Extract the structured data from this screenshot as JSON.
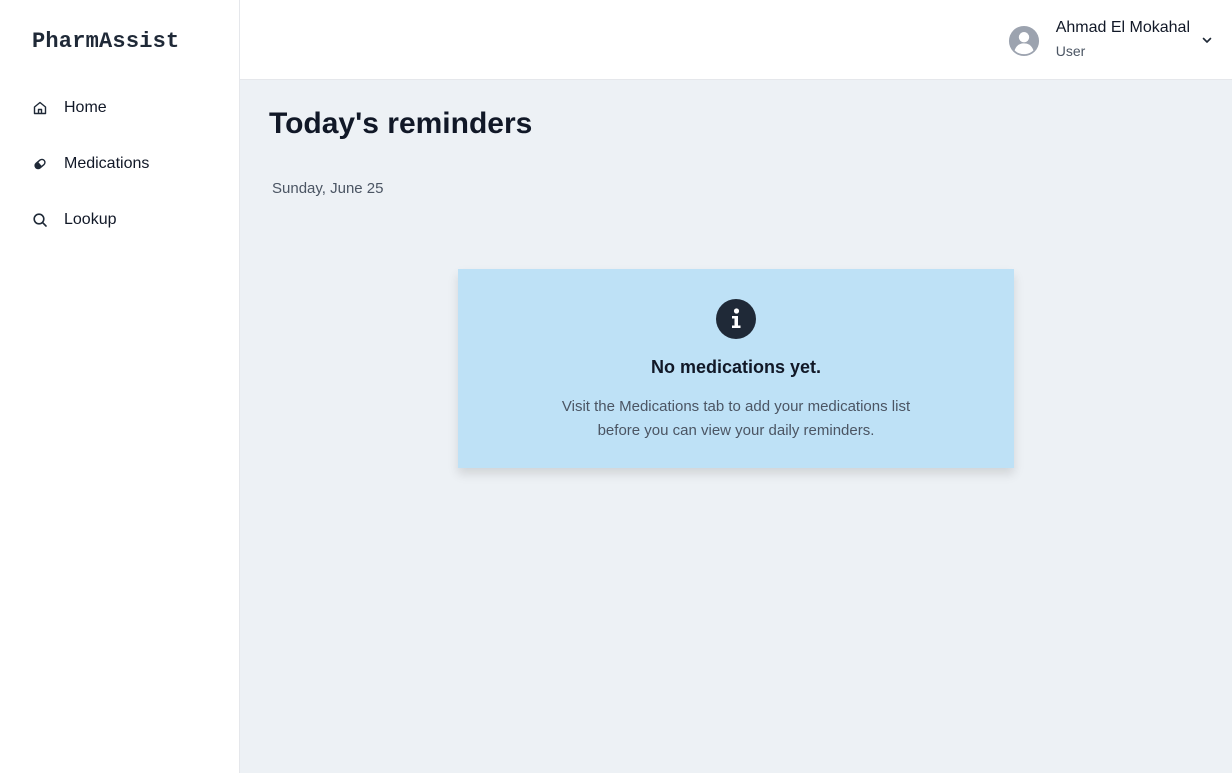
{
  "app": {
    "title": "PharmAssist"
  },
  "sidebar": {
    "items": [
      {
        "label": "Home",
        "icon": "home-icon"
      },
      {
        "label": "Medications",
        "icon": "pill-icon"
      },
      {
        "label": "Lookup",
        "icon": "search-icon"
      }
    ]
  },
  "header": {
    "user": {
      "name": "Ahmad El Mokahal",
      "role": "User",
      "avatar_icon": "user-avatar-icon",
      "menu_icon": "chevron-down-icon"
    }
  },
  "main": {
    "title": "Today's reminders",
    "date": "Sunday, June 25",
    "alert": {
      "icon": "info-icon",
      "title": "No medications yet.",
      "body": "Visit the Medications tab to add your medications list before you can view your daily reminders."
    }
  },
  "colors": {
    "main_background": "#edf1f5",
    "alert_background": "#bee1f6",
    "text_primary": "#111827",
    "text_secondary": "#4b5563",
    "icon_dark": "#1f2937"
  }
}
